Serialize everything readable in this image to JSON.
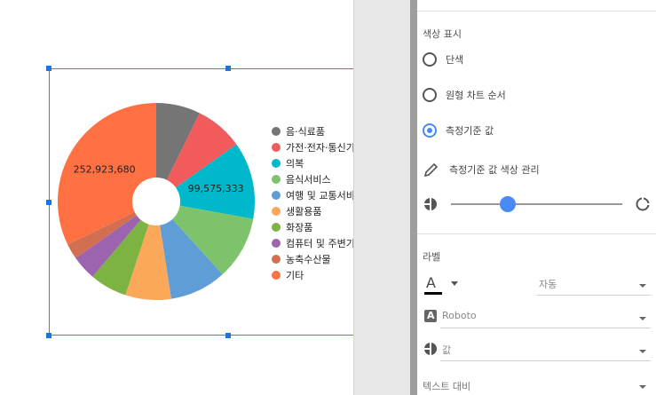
{
  "chart_data": {
    "type": "pie",
    "donut": true,
    "series": [
      {
        "name": "음·식료품",
        "value": 57000000,
        "color": "#757575"
      },
      {
        "name": "가전·전자·통신기기",
        "value": 62000000,
        "color": "#f15b5b"
      },
      {
        "name": "의복",
        "value": 99575333,
        "color": "#00b8cc"
      },
      {
        "name": "음식서비스",
        "value": 82000000,
        "color": "#7dc36b"
      },
      {
        "name": "여행 및 교통서비스",
        "value": 73000000,
        "color": "#5e9dd6"
      },
      {
        "name": "생활용품",
        "value": 59000000,
        "color": "#fba85a"
      },
      {
        "name": "화장품",
        "value": 48000000,
        "color": "#7cb342"
      },
      {
        "name": "컴퓨터 및 주변기기",
        "value": 32000000,
        "color": "#9c64ae"
      },
      {
        "name": "농축수산물",
        "value": 20000000,
        "color": "#d26e51"
      },
      {
        "name": "기타",
        "value": 252923680,
        "color": "#ff7043"
      }
    ],
    "data_labels": [
      {
        "series": "기타",
        "text": "252,923,680"
      },
      {
        "series": "의복",
        "text": "99,575,333"
      }
    ],
    "legend_position": "right"
  },
  "panel": {
    "color_section_title": "색상 표시",
    "color_options": [
      {
        "label": "단색",
        "selected": false
      },
      {
        "label": "원형 차트 순서",
        "selected": false
      },
      {
        "label": "측정기준 값",
        "selected": true
      }
    ],
    "manage_colors_label": "측정기준 값 색상 관리",
    "slider_value": 0.33,
    "label_section_title": "라벨",
    "font_color_symbol": "A",
    "label_position_value": "자동",
    "font_family_value": "Roboto",
    "label_type_value": "값",
    "text_contrast_label": "텍스트 대비"
  },
  "colors": {
    "accent": "#4a8af4",
    "selection": "#1a73e8"
  }
}
